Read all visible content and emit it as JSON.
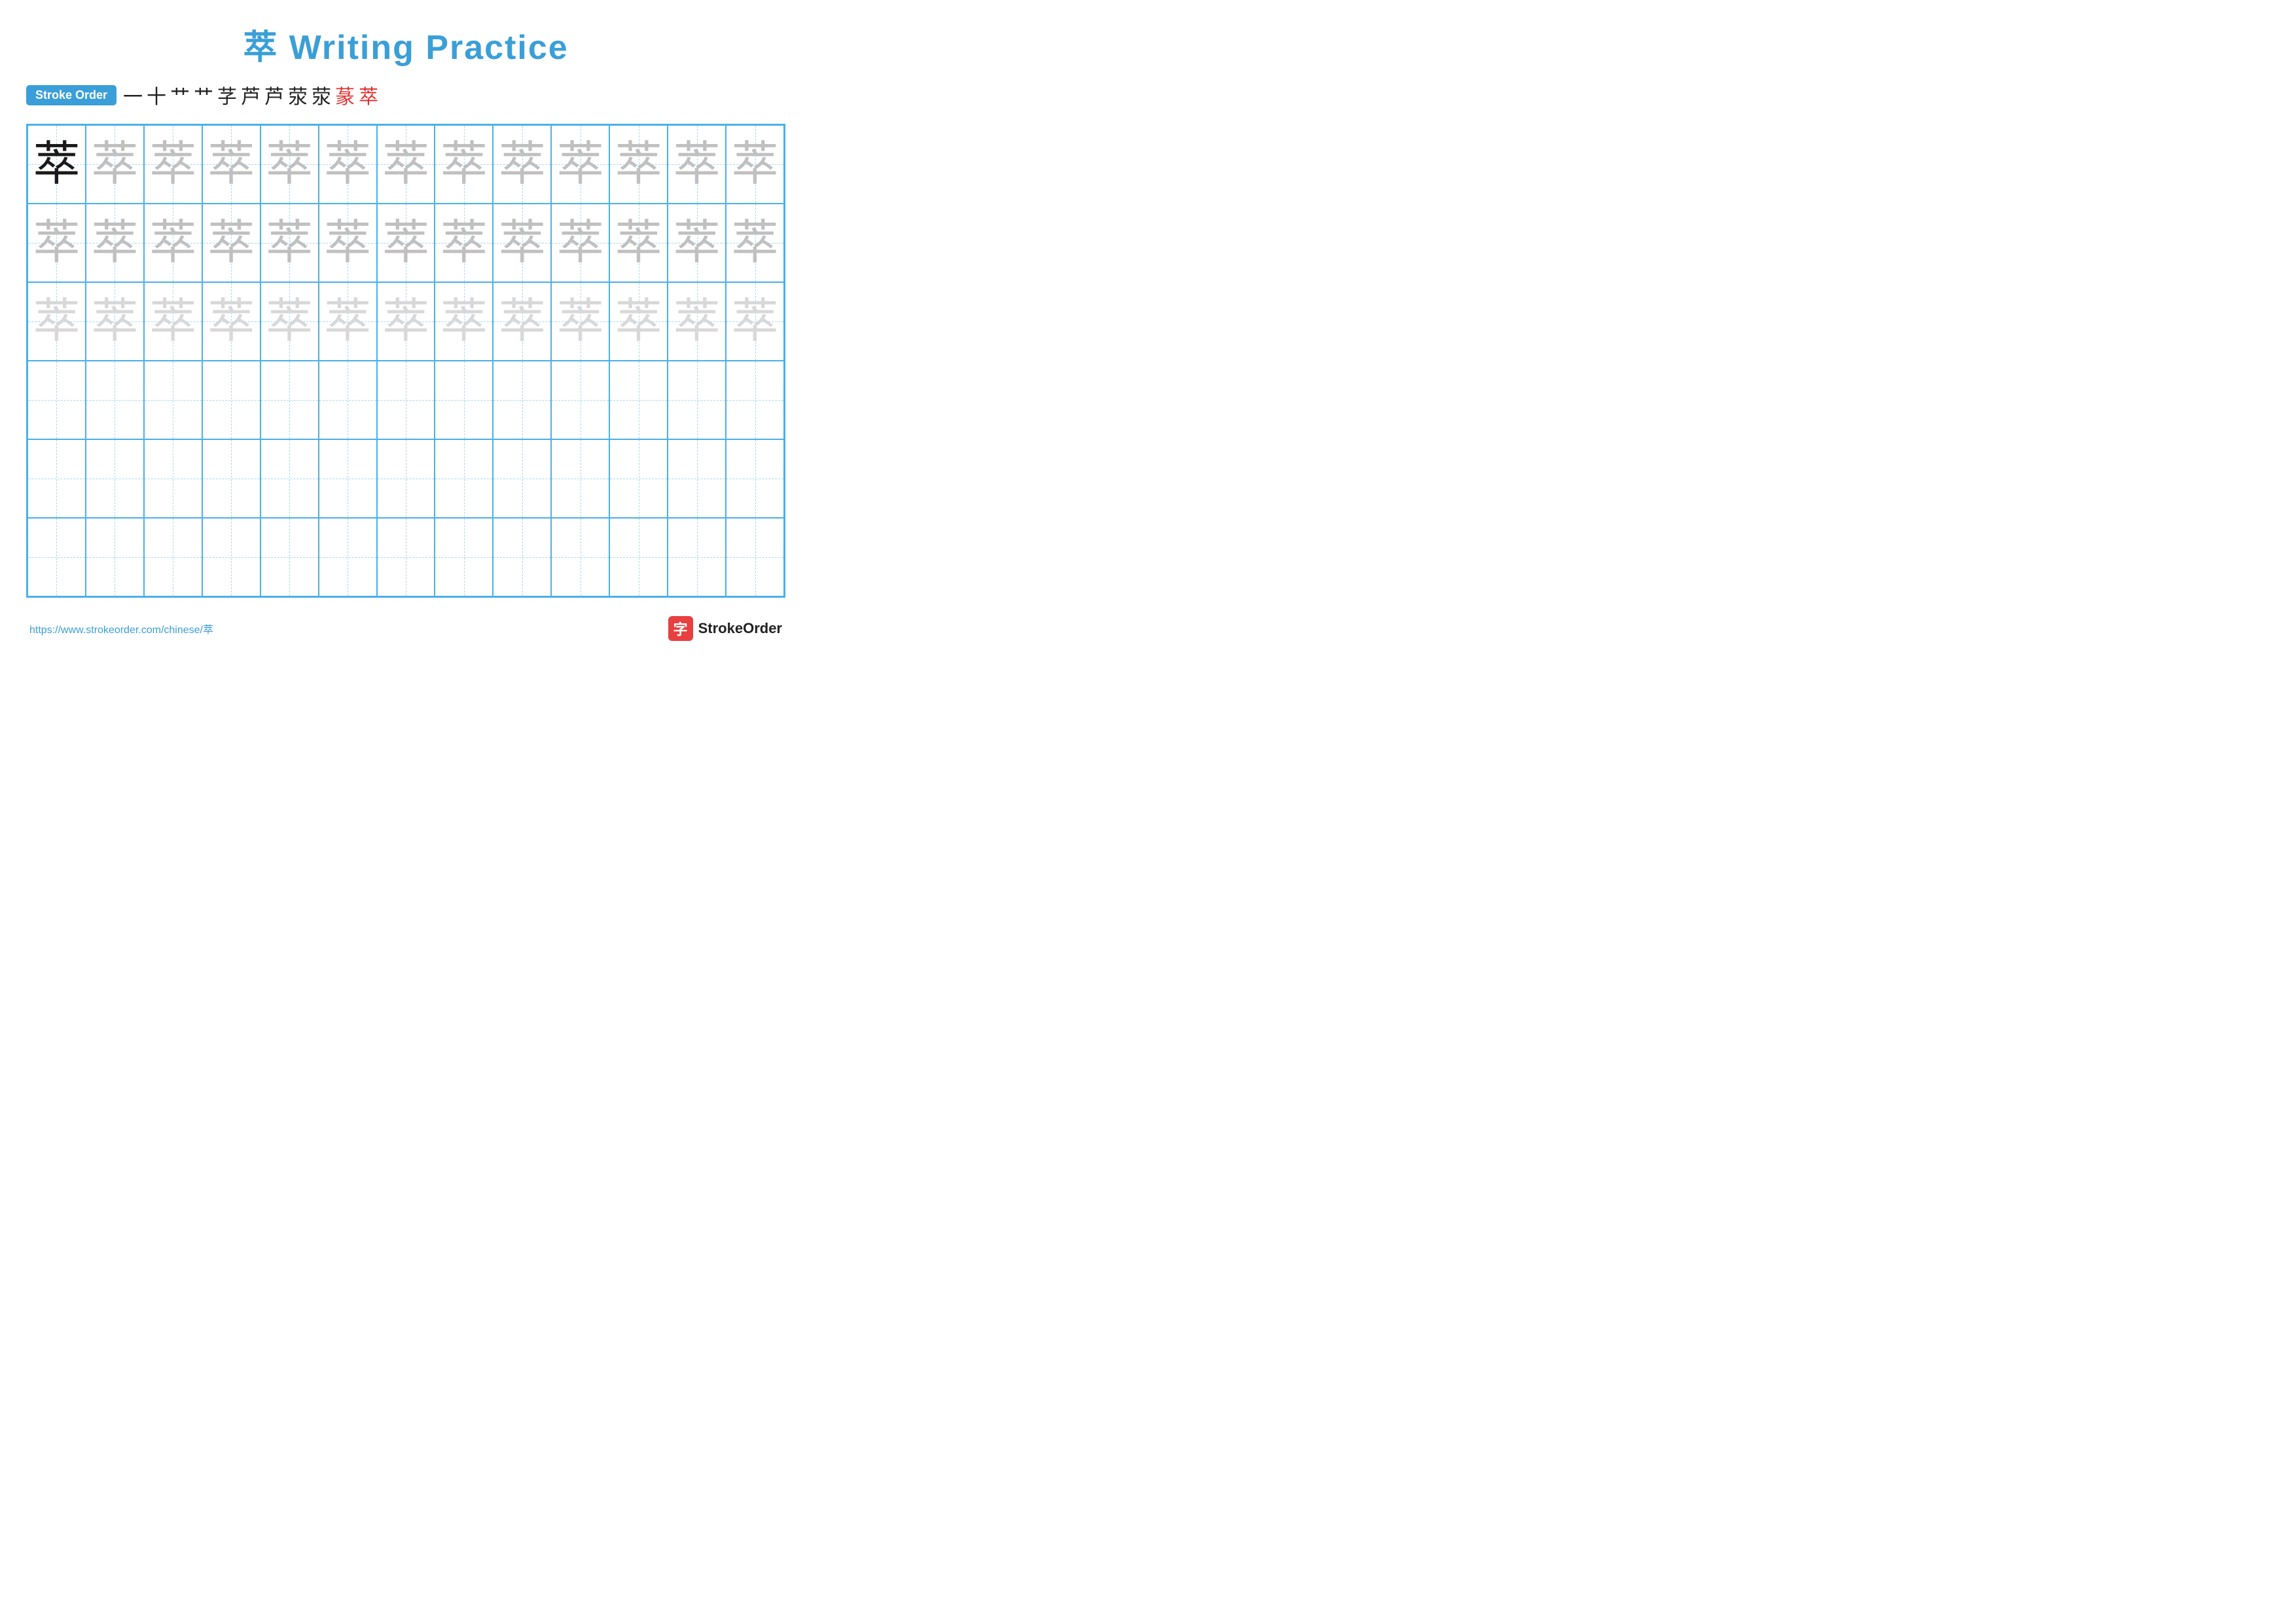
{
  "title": {
    "char": "萃",
    "text": "Writing Practice",
    "full": "萃 Writing Practice"
  },
  "stroke_order": {
    "badge_label": "Stroke Order",
    "strokes": [
      "一",
      "十",
      "艹",
      "艹",
      "芓",
      "芦",
      "芦",
      "荥",
      "荥",
      "蒃",
      "萃"
    ]
  },
  "grid": {
    "rows": 6,
    "cols": 13,
    "char": "萃",
    "row_opacities": [
      "solid",
      "medium",
      "light",
      "empty",
      "empty",
      "empty"
    ]
  },
  "footer": {
    "link_text": "https://www.strokeorder.com/chinese/萃",
    "logo_icon": "字",
    "logo_name": "StrokeOrder"
  }
}
